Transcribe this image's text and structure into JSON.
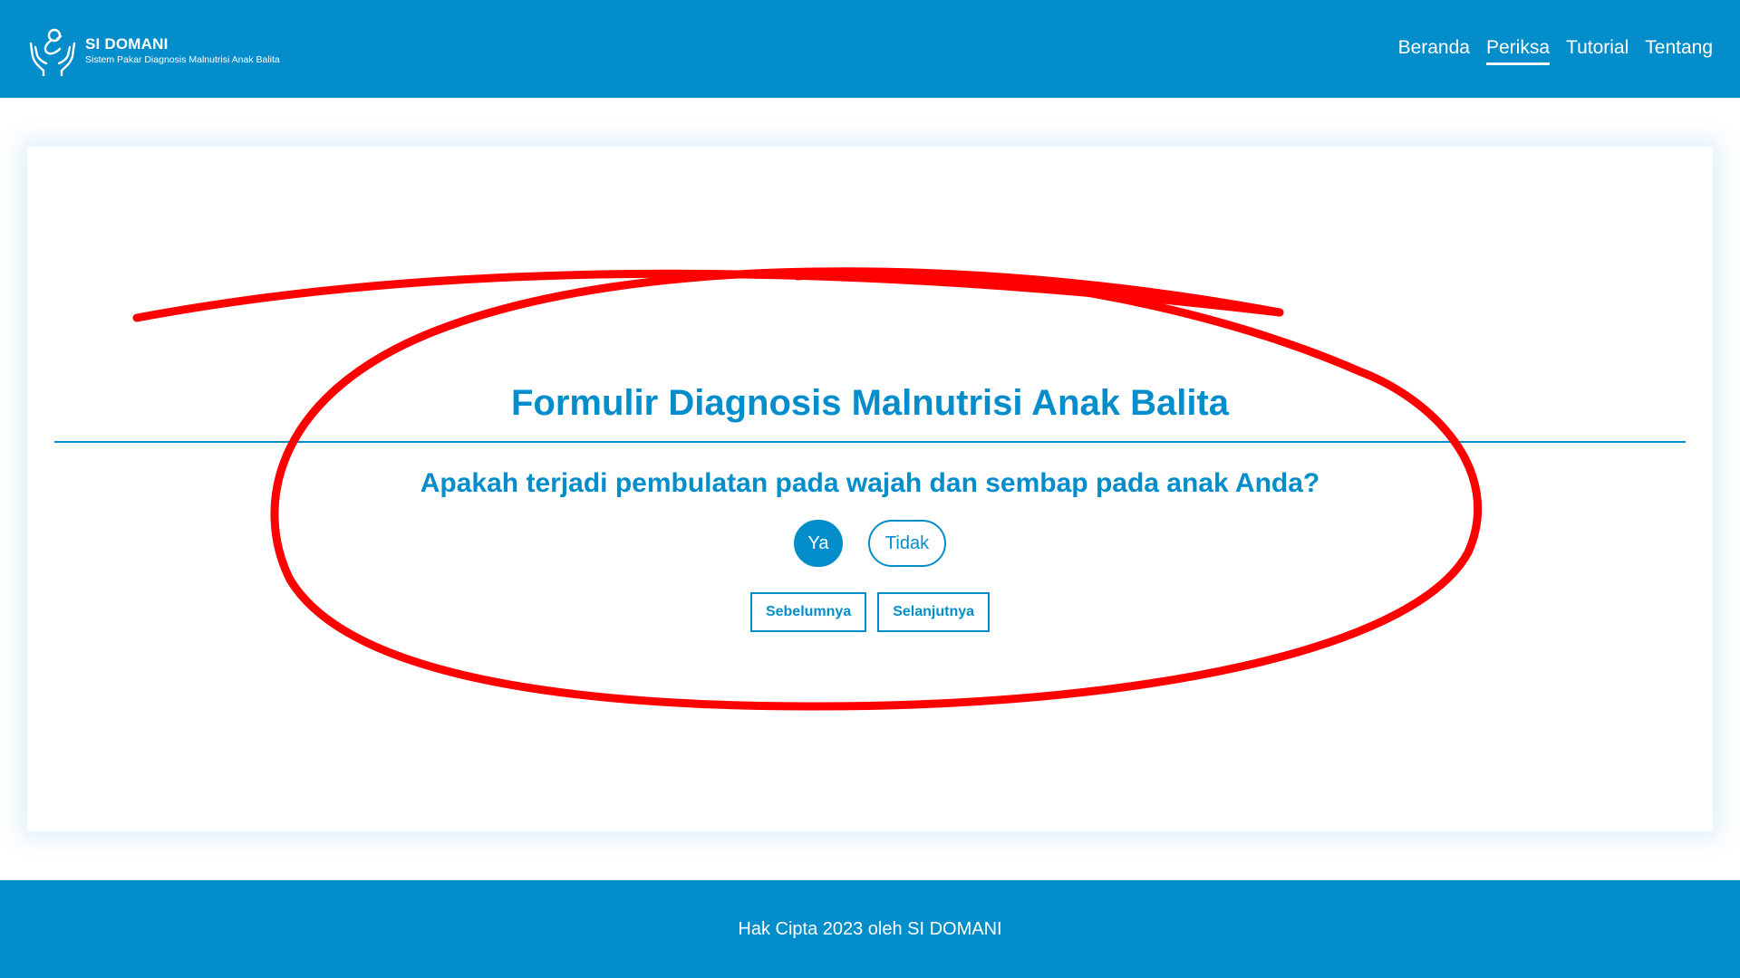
{
  "header": {
    "brand_title": "SI DOMANI",
    "brand_subtitle": "Sistem Pakar Diagnosis Malnutrisi Anak Balita",
    "logo_icon": "hands-holding-child-icon",
    "nav": [
      {
        "label": "Beranda",
        "active": false
      },
      {
        "label": "Periksa",
        "active": true
      },
      {
        "label": "Tutorial",
        "active": false
      },
      {
        "label": "Tentang",
        "active": false
      }
    ]
  },
  "form": {
    "title": "Formulir Diagnosis Malnutrisi Anak Balita",
    "question": "Apakah terjadi pembulatan pada wajah dan sembap pada anak Anda?",
    "answers": {
      "yes_label": "Ya",
      "no_label": "Tidak",
      "selected": "Ya"
    },
    "prev_label": "Sebelumnya",
    "next_label": "Selanjutnya"
  },
  "footer": {
    "copyright": "Hak Cipta 2023 oleh SI DOMANI"
  },
  "colors": {
    "primary": "#038dcb",
    "annotation": "#ff0000",
    "background": "#ffffff"
  }
}
